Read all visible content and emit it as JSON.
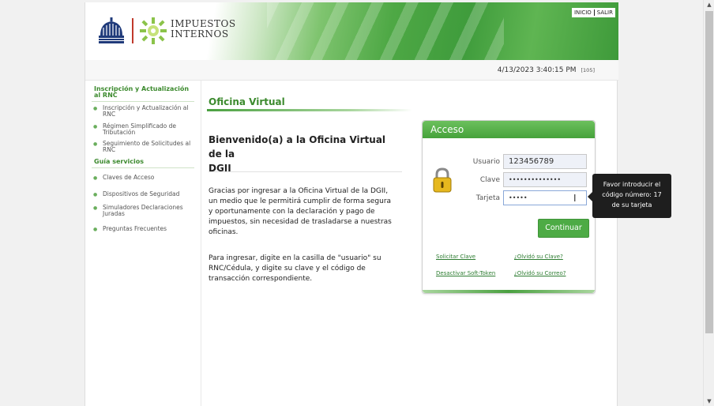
{
  "header": {
    "logo_line1": "IMPUESTOS",
    "logo_line2": "INTERNOS",
    "link_inicio": "INICIO",
    "link_salir": "SALIR",
    "brand_green": "#46a23b"
  },
  "infobar": {
    "datetime": "4/13/2023 3:40:15 PM",
    "session_code": "[105]"
  },
  "sidebar": {
    "section1_title_line1": "Inscripción y Actualización",
    "section1_title_line2": "al RNC",
    "items1": [
      {
        "line1": "Inscripción y Actualización al",
        "line2": "RNC"
      },
      {
        "line1": "Régimen Simplificado de",
        "line2": "Tributación"
      },
      {
        "line1": "Seguimiento de Solicitudes al",
        "line2": "RNC"
      }
    ],
    "section2_title": "Guía servicios",
    "items2": [
      {
        "line1": "Claves de Acceso",
        "line2": ""
      },
      {
        "line1": "Dispositivos de Seguridad",
        "line2": ""
      },
      {
        "line1": "Simuladores Declaraciones",
        "line2": "Juradas"
      },
      {
        "line1": "Preguntas Frecuentes",
        "line2": ""
      }
    ]
  },
  "main": {
    "title": "Oficina Virtual",
    "welcome_line1": "Bienvenido(a) a la Oficina Virtual de la",
    "welcome_line2": "DGII",
    "para1": [
      "Gracias por ingresar a la Oficina Virtual de la DGII,",
      "un medio que le permitirá cumplir de forma segura",
      "y oportunamente con la declaración y pago de",
      "impuestos, sin necesidad de trasladarse a nuestras",
      "oficinas."
    ],
    "para2": [
      "Para ingresar, digite en la casilla de \"usuario\" su",
      "RNC/Cédula, y digite su clave y el código de",
      "transacción correspondiente."
    ]
  },
  "login": {
    "title": "Acceso",
    "usuario_label": "Usuario",
    "usuario_value": "123456789",
    "clave_label": "Clave",
    "clave_value": "••••••••••••••",
    "tarjeta_label": "Tarjeta",
    "tarjeta_value": "•••••",
    "continue_label": "Continuar",
    "link_solicitar": "Solicitar Clave",
    "link_olvido_clave": "¿Olvidó su Clave?",
    "link_desactivar": "Desactivar Soft-Token",
    "link_olvido_correo": "¿Olvidó su Correo?"
  },
  "tooltip": {
    "line1": "Favor introducir el",
    "line2": "código número: 17",
    "line3": "de su tarjeta"
  },
  "icons": {
    "lock": "padlock-icon",
    "seal": "national-seal-icon",
    "burst": "dgii-burst-icon",
    "cursor": "text-cursor-icon"
  }
}
